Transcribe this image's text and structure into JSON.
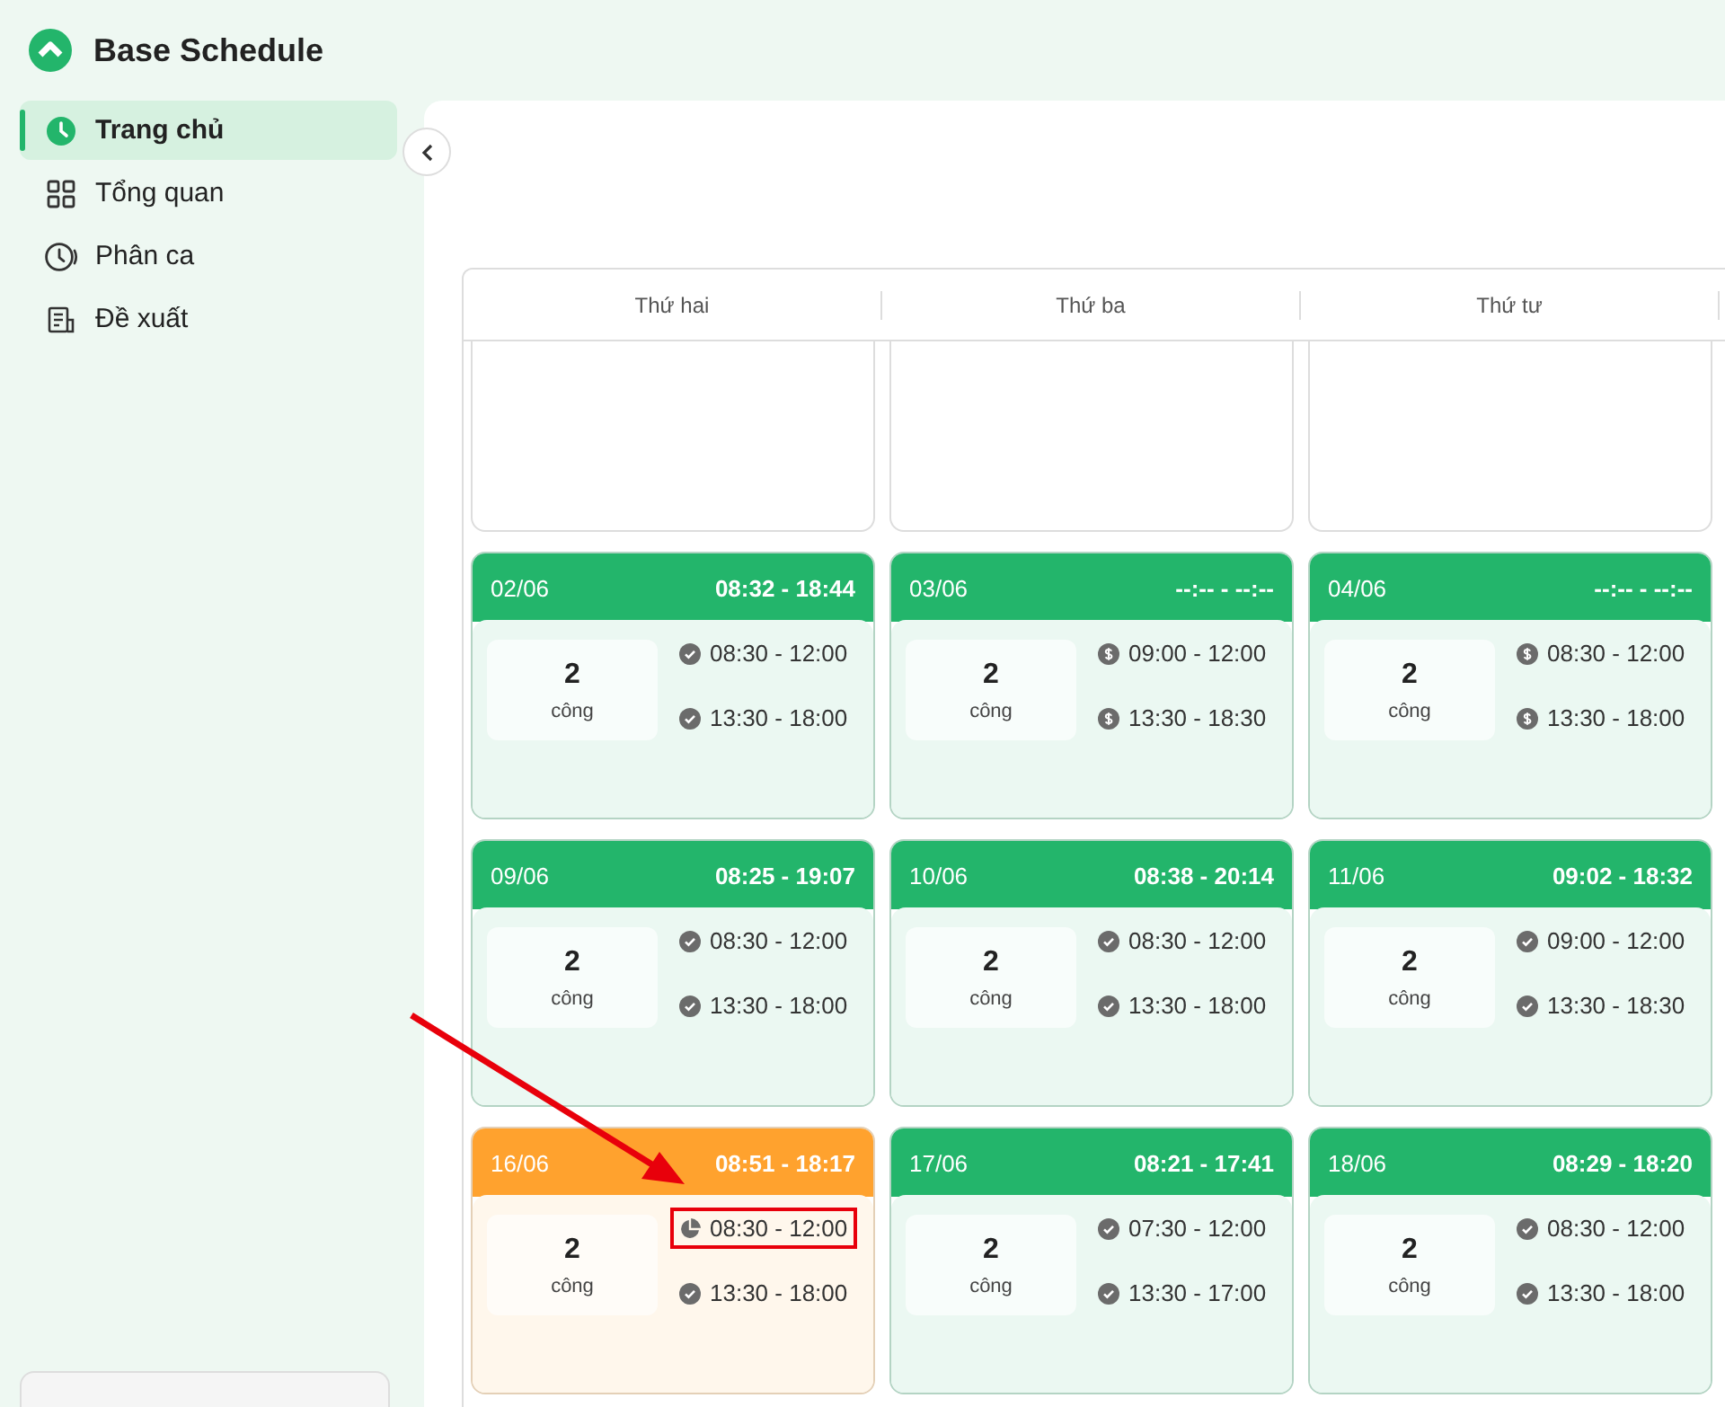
{
  "app": {
    "title": "Base Schedule"
  },
  "sidebar": {
    "items": [
      {
        "label": "Trang chủ",
        "selected": true
      },
      {
        "label": "Tổng quan",
        "selected": false
      },
      {
        "label": "Phân ca",
        "selected": false
      },
      {
        "label": "Đề xuất",
        "selected": false
      }
    ]
  },
  "calendar": {
    "columns": [
      "Thứ hai",
      "Thứ ba",
      "Thứ tư"
    ],
    "weeks": [
      {
        "days": [
          {
            "kind": "empty"
          },
          {
            "kind": "empty"
          },
          {
            "kind": "empty"
          }
        ]
      },
      {
        "days": [
          {
            "kind": "day",
            "color": "#23b56b",
            "date": "02/06",
            "checkin": "08:32 - 18:44",
            "count": "2",
            "unit": "công",
            "shifts": [
              {
                "kind": "done",
                "time": "08:30 - 12:00"
              },
              {
                "kind": "done",
                "time": "13:30 - 18:00"
              }
            ]
          },
          {
            "kind": "day",
            "color": "#23b56b",
            "date": "03/06",
            "checkin": "--:-- - --:--",
            "count": "2",
            "unit": "công",
            "shifts": [
              {
                "kind": "paid",
                "time": "09:00 - 12:00"
              },
              {
                "kind": "paid",
                "time": "13:30 - 18:30"
              }
            ]
          },
          {
            "kind": "day",
            "color": "#23b56b",
            "date": "04/06",
            "checkin": "--:-- - --:--",
            "count": "2",
            "unit": "công",
            "shifts": [
              {
                "kind": "paid",
                "time": "08:30 - 12:00"
              },
              {
                "kind": "paid",
                "time": "13:30 - 18:00"
              }
            ]
          }
        ]
      },
      {
        "days": [
          {
            "kind": "day",
            "color": "#23b56b",
            "date": "09/06",
            "checkin": "08:25 - 19:07",
            "count": "2",
            "unit": "công",
            "shifts": [
              {
                "kind": "done",
                "time": "08:30 - 12:00"
              },
              {
                "kind": "done",
                "time": "13:30 - 18:00"
              }
            ]
          },
          {
            "kind": "day",
            "color": "#23b56b",
            "date": "10/06",
            "checkin": "08:38 - 20:14",
            "count": "2",
            "unit": "công",
            "shifts": [
              {
                "kind": "done",
                "time": "08:30 - 12:00"
              },
              {
                "kind": "done",
                "time": "13:30 - 18:00"
              }
            ]
          },
          {
            "kind": "day",
            "color": "#23b56b",
            "date": "11/06",
            "checkin": "09:02 - 18:32",
            "count": "2",
            "unit": "công",
            "shifts": [
              {
                "kind": "done",
                "time": "09:00 - 12:00"
              },
              {
                "kind": "done",
                "time": "13:30 - 18:30"
              }
            ]
          }
        ]
      },
      {
        "days": [
          {
            "kind": "day",
            "color": "#ffa22e",
            "date": "16/06",
            "checkin": "08:51 - 18:17",
            "count": "2",
            "unit": "công",
            "shifts": [
              {
                "kind": "partial",
                "time": "08:30 - 12:00",
                "highlighted": true
              },
              {
                "kind": "done",
                "time": "13:30 - 18:00",
                "highlighted": false
              }
            ]
          },
          {
            "kind": "day",
            "color": "#23b56b",
            "date": "17/06",
            "checkin": "08:21 - 17:41",
            "count": "2",
            "unit": "công",
            "shifts": [
              {
                "kind": "done",
                "time": "07:30 - 12:00"
              },
              {
                "kind": "done",
                "time": "13:30 - 17:00"
              }
            ]
          },
          {
            "kind": "day",
            "color": "#23b56b",
            "date": "18/06",
            "checkin": "08:29 - 18:20",
            "count": "2",
            "unit": "công",
            "shifts": [
              {
                "kind": "done",
                "time": "08:30 - 12:00"
              },
              {
                "kind": "done",
                "time": "13:30 - 18:00"
              }
            ]
          }
        ]
      }
    ]
  }
}
